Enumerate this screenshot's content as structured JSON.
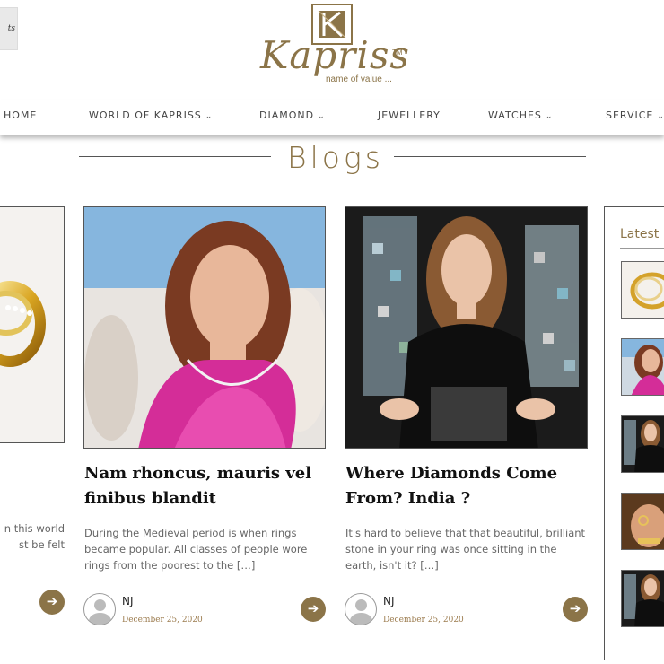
{
  "header": {
    "corner_text": "ts",
    "logo_name": "Kapriss",
    "logo_tm": "TM",
    "logo_tagline": "name of value ...",
    "logo_monogram": "K"
  },
  "nav": {
    "items": [
      {
        "label": "HOME",
        "has_dropdown": false
      },
      {
        "label": "WORLD OF KAPRISS",
        "has_dropdown": true
      },
      {
        "label": "DIAMOND",
        "has_dropdown": true
      },
      {
        "label": "JEWELLERY",
        "has_dropdown": false
      },
      {
        "label": "WATCHES",
        "has_dropdown": true
      },
      {
        "label": "SERVICE",
        "has_dropdown": true
      }
    ],
    "chevron": "⌄"
  },
  "section_title": "Blogs",
  "posts": [
    {
      "image": "gold-diamond-ring-photo",
      "title": "",
      "excerpt_line1": "n this world",
      "excerpt_line2": "st be felt",
      "arrow_icon": "arrow-right-icon"
    },
    {
      "image": "woman-pink-dress-necklace-photo",
      "title": "Nam rhoncus, mauris vel finibus blandit",
      "excerpt": "During the Medieval period is when rings became popular. All classes of people wore rings from the poorest to the […]",
      "author": "NJ",
      "date": "December 25, 2020",
      "arrow_icon": "arrow-right-icon"
    },
    {
      "image": "woman-black-blouse-mosaic-photo",
      "title": "Where Diamonds Come From? India ?",
      "excerpt": "It's hard to believe that that beautiful, brilliant stone in your ring was once sitting in the earth, isn't it? […]",
      "author": "NJ",
      "date": "December 25, 2020",
      "arrow_icon": "arrow-right-icon"
    }
  ],
  "sidebar": {
    "title": "Latest Blogs",
    "thumbnails": [
      "ring-thumbnail",
      "woman-pink-thumbnail",
      "woman-black-thumbnail",
      "hand-jewellery-thumbnail",
      "woman-black-thumbnail-2"
    ]
  },
  "colors": {
    "brand_gold": "#8b7448",
    "date_gold": "#9c7c4f",
    "text_dark": "#111111",
    "text_body": "#666666"
  }
}
